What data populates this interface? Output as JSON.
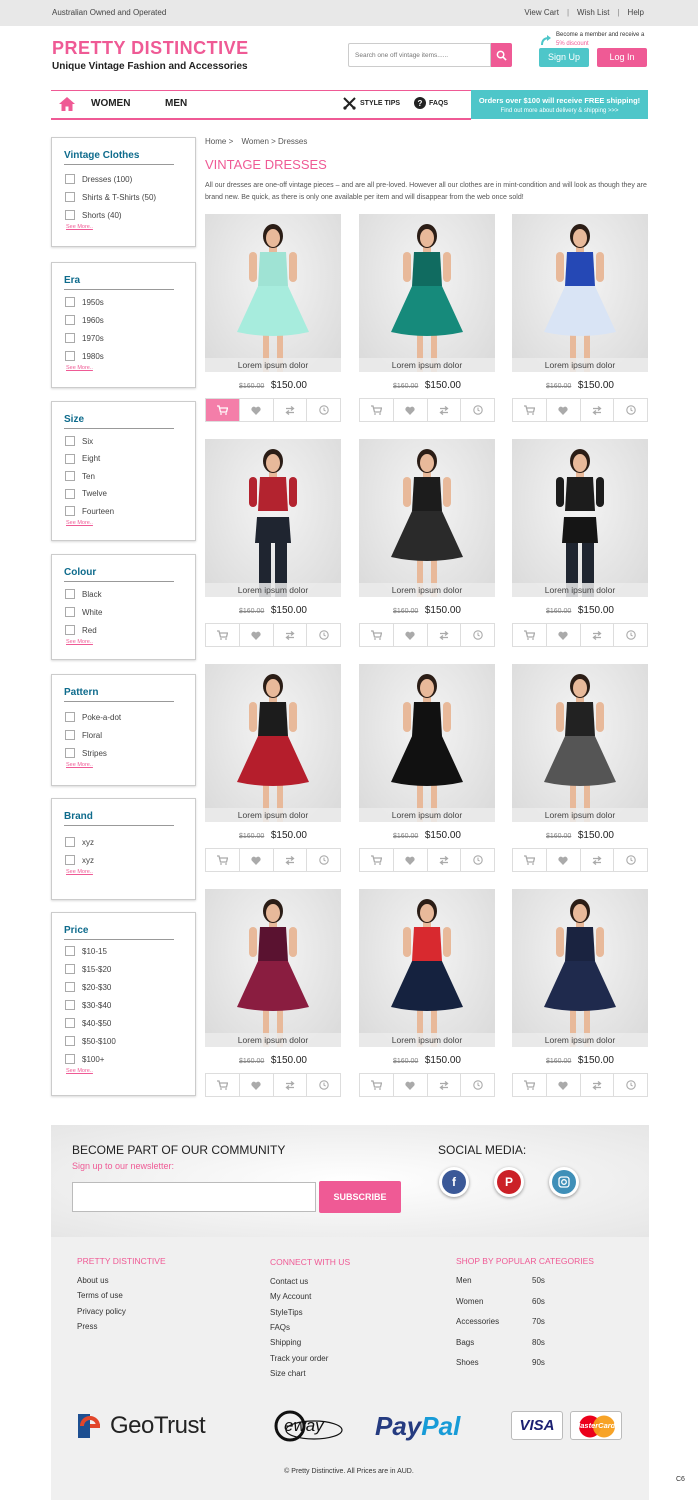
{
  "topbar": {
    "tagline": "Australian Owned and Operated",
    "links": [
      "View Cart",
      "Wish List",
      "Help"
    ]
  },
  "header": {
    "logo_title": "PRETTY DISTINCTIVE",
    "logo_sub": "Unique Vintage Fashion and Accessories",
    "search_placeholder": "Search one off vintage items......",
    "promo_line1": "Become a member and receive a",
    "promo_line2": "5% discount",
    "signup": "Sign Up",
    "login": "Log In"
  },
  "nav": {
    "women": "WOMEN",
    "men": "MEN",
    "style_tips": "STYLE TIPS",
    "faqs": "FAQS",
    "ship_line1": "Orders over $100 will receive FREE shipping!",
    "ship_line2": "Find out more about delivery & shipping >>>"
  },
  "filters": [
    {
      "title": "Vintage Clothes",
      "items": [
        "Dresses (100)",
        "Shirts & T-Shirts (50)",
        "Shorts (40)"
      ],
      "more": "See More.."
    },
    {
      "title": "Era",
      "items": [
        "1950s",
        "1960s",
        "1970s",
        "1980s"
      ],
      "more": "See More.."
    },
    {
      "title": "Size",
      "items": [
        "Six",
        "Eight",
        "Ten",
        "Twelve",
        "Fourteen"
      ],
      "more": "See More.."
    },
    {
      "title": "Colour",
      "items": [
        "Black",
        "White",
        "Red"
      ],
      "more": "See More.."
    },
    {
      "title": "Pattern",
      "items": [
        "Poke-a-dot",
        "Floral",
        "Stripes"
      ],
      "more": "See More.."
    },
    {
      "title": "Brand",
      "items": [
        "xyz",
        "xyz"
      ],
      "more": "See More.."
    },
    {
      "title": "Price",
      "items": [
        "$10-15",
        "$15-$20",
        "$20-$30",
        "$30-$40",
        "$40-$50",
        "$50-$100",
        "$100+"
      ],
      "more": "See More.."
    }
  ],
  "breadcrumb": [
    "Home >",
    "Women > Dresses"
  ],
  "page_title": "VINTAGE DRESSES",
  "page_desc": "All our dresses are one-off vintage pieces – and are all pre-loved. However all our clothes are in mint-condition and will look as though they are brand new. Be quick, as there is only one available per item and will disappear from the web once sold!",
  "products": [
    {
      "name": "Lorem ipsum dolor",
      "old_price": "$160.00",
      "price": "$150.00",
      "dress": "#9fe3d4",
      "top": "#9fe3d4",
      "skirt": "#a7ecdd",
      "legs": "skin"
    },
    {
      "name": "Lorem ipsum dolor",
      "old_price": "$160.00",
      "price": "$150.00",
      "dress": "#137a6e",
      "top": "#106b60",
      "skirt": "#168a7b",
      "legs": "skin"
    },
    {
      "name": "Lorem ipsum dolor",
      "old_price": "$160.00",
      "price": "$150.00",
      "dress": "#2b53c9",
      "top": "#2548b5",
      "skirt": "#d9e4f5",
      "legs": "skin"
    },
    {
      "name": "Lorem ipsum dolor",
      "old_price": "$160.00",
      "price": "$150.00",
      "dress": "#b3232f",
      "top": "#b3232f",
      "skirt": "#1f2530",
      "legs": "pants"
    },
    {
      "name": "Lorem ipsum dolor",
      "old_price": "$160.00",
      "price": "$150.00",
      "dress": "#1c1c1c",
      "top": "#1c1c1c",
      "skirt": "#2a2a2a",
      "legs": "skin"
    },
    {
      "name": "Lorem ipsum dolor",
      "old_price": "$160.00",
      "price": "$150.00",
      "dress": "#1c1c1c",
      "top": "#1c1c1c",
      "skirt": "#151515",
      "legs": "pants"
    },
    {
      "name": "Lorem ipsum dolor",
      "old_price": "$160.00",
      "price": "$150.00",
      "dress": "#1c1c1c",
      "top": "#1c1c1c",
      "skirt": "#b51e2c",
      "legs": "skin"
    },
    {
      "name": "Lorem ipsum dolor",
      "old_price": "$160.00",
      "price": "$150.00",
      "dress": "#111111",
      "top": "#111111",
      "skirt": "#111111",
      "legs": "skin"
    },
    {
      "name": "Lorem ipsum dolor",
      "old_price": "$160.00",
      "price": "$150.00",
      "dress": "#333333",
      "top": "#222222",
      "skirt": "#555555",
      "legs": "skin"
    },
    {
      "name": "Lorem ipsum dolor",
      "old_price": "$160.00",
      "price": "$150.00",
      "dress": "#6b1634",
      "top": "#5a1230",
      "skirt": "#8a1d40",
      "legs": "skin"
    },
    {
      "name": "Lorem ipsum dolor",
      "old_price": "$160.00",
      "price": "$150.00",
      "dress": "#d8292f",
      "top": "#d8292f",
      "skirt": "#15223f",
      "legs": "skin"
    },
    {
      "name": "Lorem ipsum dolor",
      "old_price": "$160.00",
      "price": "$150.00",
      "dress": "#1a2340",
      "top": "#1a2340",
      "skirt": "#1f2a4d",
      "legs": "skin"
    }
  ],
  "community": {
    "title": "BECOME PART OF OUR COMMUNITY",
    "subtitle": "Sign up to our newsletter:",
    "button": "SUBSCRIBE",
    "social_title": "SOCIAL MEDIA:",
    "social": [
      "facebook-icon",
      "pinterest-icon",
      "instagram-icon"
    ]
  },
  "footer": {
    "col1_title": "PRETTY DISTINCTIVE",
    "col1_links": [
      "About us",
      "Terms of use",
      "Privacy policy",
      "Press"
    ],
    "col2_title": "CONNECT WITH US",
    "col2_links": [
      "Contact us",
      "My Account",
      "StyleTips",
      "FAQs",
      "Shipping",
      "Track your order",
      "Size chart"
    ],
    "col3_title": "SHOP BY POPULAR CATEGORIES",
    "col3_categories": [
      "Men",
      "Women",
      "Accessories",
      "Bags",
      "Shoes"
    ],
    "col3_eras": [
      "50s",
      "60s",
      "70s",
      "80s",
      "90s"
    ],
    "copyright": "© Pretty Distinctive. All Prices are in AUD.",
    "corner": "C6"
  },
  "payment": {
    "geotrust": "GeoTrust",
    "eway": "eway",
    "paypal_1": "Pay",
    "paypal_2": "Pal",
    "visa": "VISA",
    "mastercard": "MasterCard"
  },
  "colors": {
    "pink": "#ef5a95",
    "teal": "#4ec6c9",
    "navy": "#0e6b8c"
  }
}
